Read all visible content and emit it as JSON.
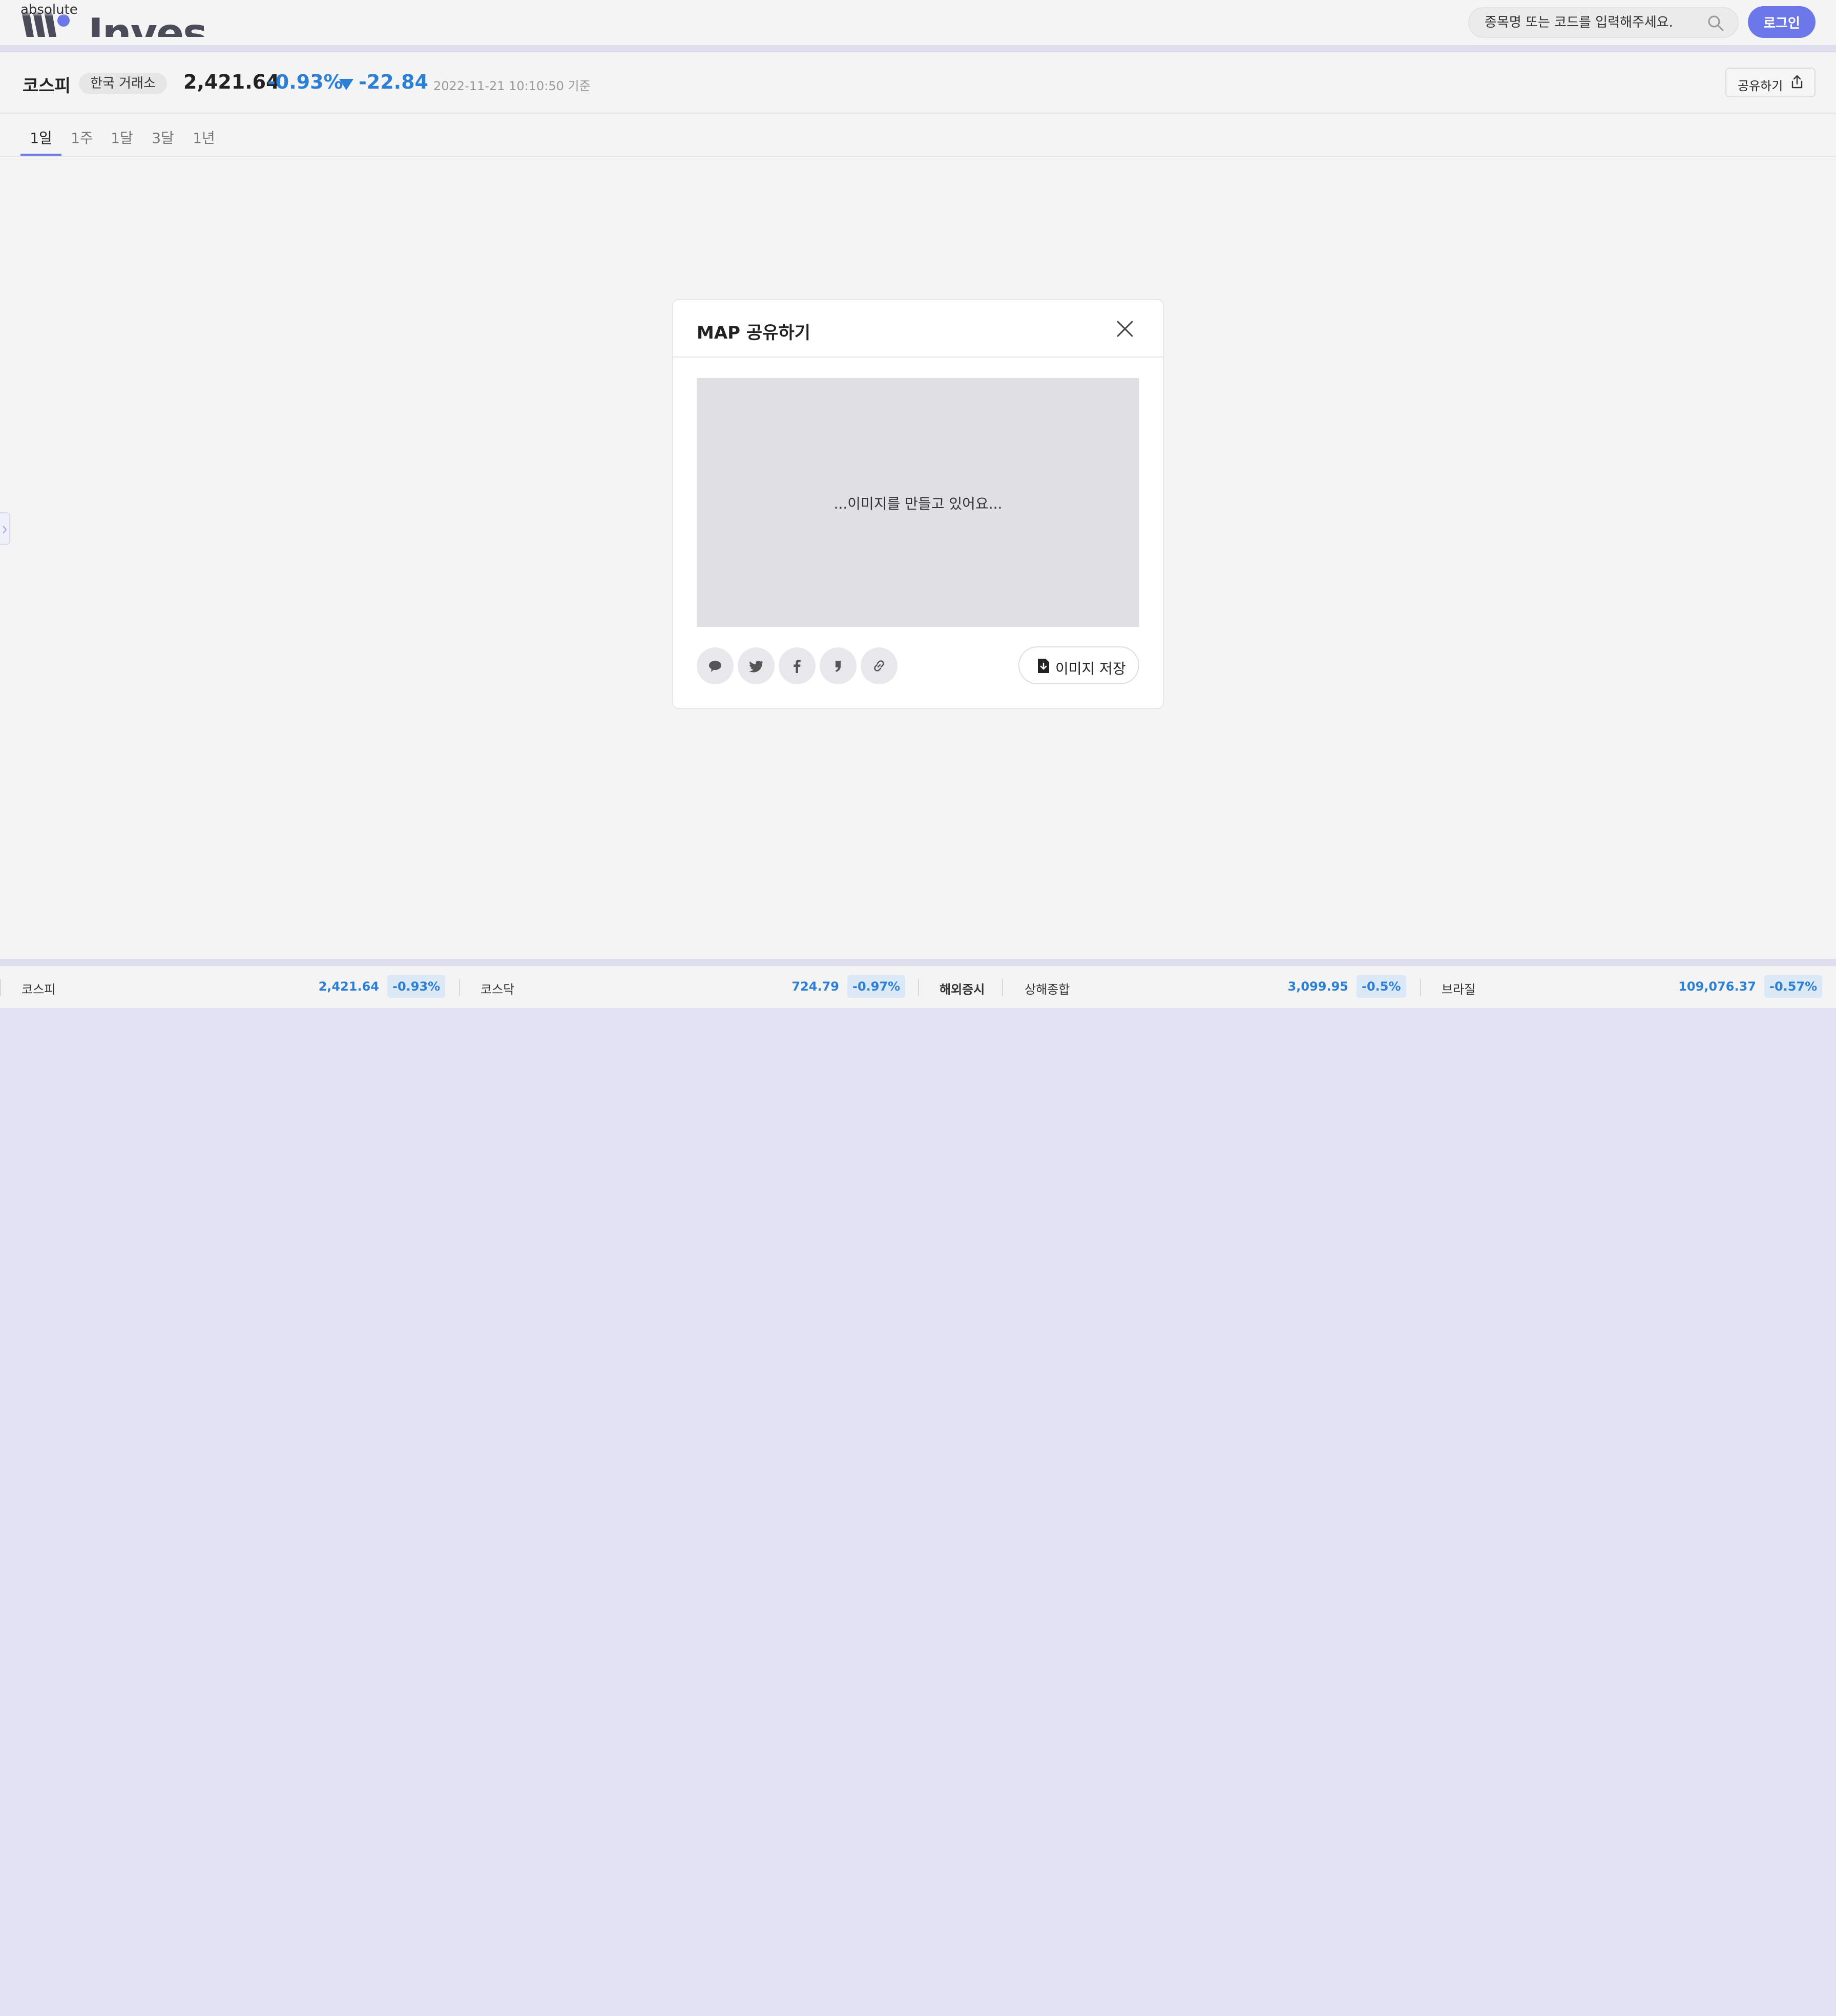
{
  "header": {
    "logo_small": "absolute",
    "logo_big": "Invest",
    "search_placeholder": "종목명 또는 코드를 입력해주세요.",
    "login_label": "로그인"
  },
  "index": {
    "name": "코스피",
    "exchange": "한국 거래소",
    "value": "2,421.64",
    "rate": "-0.93%",
    "change": "-22.84",
    "timestamp": "2022-11-21 10:10:50 기준",
    "share_label": "공유하기",
    "direction": "down"
  },
  "tabs": [
    {
      "label": "1일",
      "active": true
    },
    {
      "label": "1주",
      "active": false
    },
    {
      "label": "1달",
      "active": false
    },
    {
      "label": "3달",
      "active": false
    },
    {
      "label": "1년",
      "active": false
    }
  ],
  "modal": {
    "title": "MAP 공유하기",
    "preview_text": "...이미지를 만들고 있어요...",
    "save_label": "이미지 저장",
    "share_targets": [
      "kakaotalk-icon",
      "twitter-icon",
      "facebook-icon",
      "quote-icon",
      "link-icon"
    ]
  },
  "ticker": {
    "items": [
      {
        "name": "코스피",
        "value": "2,421.64",
        "rate": "-0.93%"
      },
      {
        "name": "코스닥",
        "value": "724.79",
        "rate": "-0.97%"
      },
      {
        "name": "상해종합",
        "value": "3,099.95",
        "rate": "-0.5%"
      },
      {
        "name": "브라질",
        "value": "109,076.37",
        "rate": "-0.57%"
      }
    ],
    "section_label": "해외증시"
  },
  "colors": {
    "accent": "#6c78e8",
    "down": "#2c7fd6",
    "page_bg": "#f4f4f4",
    "outer_bg": "#e2e2f4"
  }
}
